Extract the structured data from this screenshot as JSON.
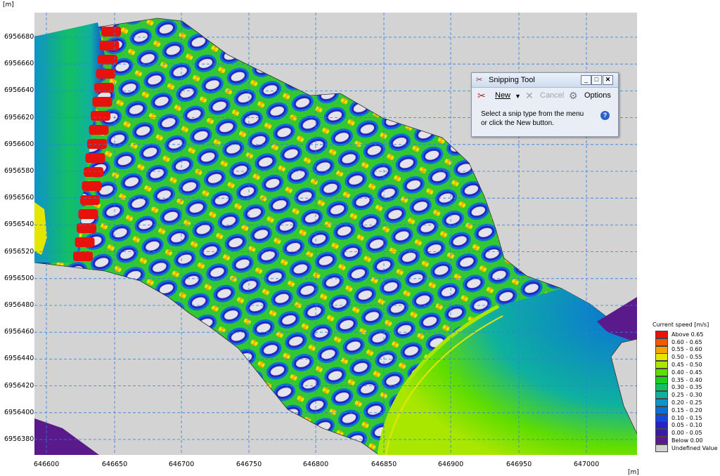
{
  "axes": {
    "y_unit": "[m]",
    "x_unit": "[m]",
    "yticks": [
      "6956680",
      "6956660",
      "6956640",
      "6956620",
      "6956600",
      "6956580",
      "6956560",
      "6956540",
      "6956520",
      "6956500",
      "6956480",
      "6956460",
      "6956440",
      "6956420",
      "6956400",
      "6956380"
    ],
    "xticks": [
      "646600",
      "646650",
      "646700",
      "646750",
      "646800",
      "646850",
      "646900",
      "646950",
      "647000"
    ]
  },
  "snipping_tool": {
    "title": "Snipping Tool",
    "new_label": "New",
    "cancel_label": "Cancel",
    "options_label": "Options",
    "message_line1": "Select a snip type from the menu",
    "message_line2": "or click the New button.",
    "help": "?"
  },
  "legend": {
    "title": "Current speed [m/s]",
    "items": [
      {
        "label": "Above 0.65",
        "color": "#e8120c"
      },
      {
        "label": "0.60 - 0.65",
        "color": "#f25a08"
      },
      {
        "label": "0.55 - 0.60",
        "color": "#f7a300"
      },
      {
        "label": "0.50 - 0.55",
        "color": "#e5e600"
      },
      {
        "label": "0.45 - 0.50",
        "color": "#a9e600"
      },
      {
        "label": "0.40 - 0.45",
        "color": "#5fdd00"
      },
      {
        "label": "0.35 - 0.40",
        "color": "#1ccf1c"
      },
      {
        "label": "0.30 - 0.35",
        "color": "#12c063"
      },
      {
        "label": "0.25 - 0.30",
        "color": "#0fb0a0"
      },
      {
        "label": "0.20 - 0.25",
        "color": "#0d94c8"
      },
      {
        "label": "0.15 - 0.20",
        "color": "#0a70d8"
      },
      {
        "label": "0.10 - 0.15",
        "color": "#1747d6"
      },
      {
        "label": "0.05 - 0.10",
        "color": "#2424c2"
      },
      {
        "label": "0.00 - 0.05",
        "color": "#3a1aa6"
      },
      {
        "label": "Below 0.00",
        "color": "#5a1a8c"
      },
      {
        "label": "Undefined Value",
        "color": "#d3d3d3"
      }
    ]
  }
}
